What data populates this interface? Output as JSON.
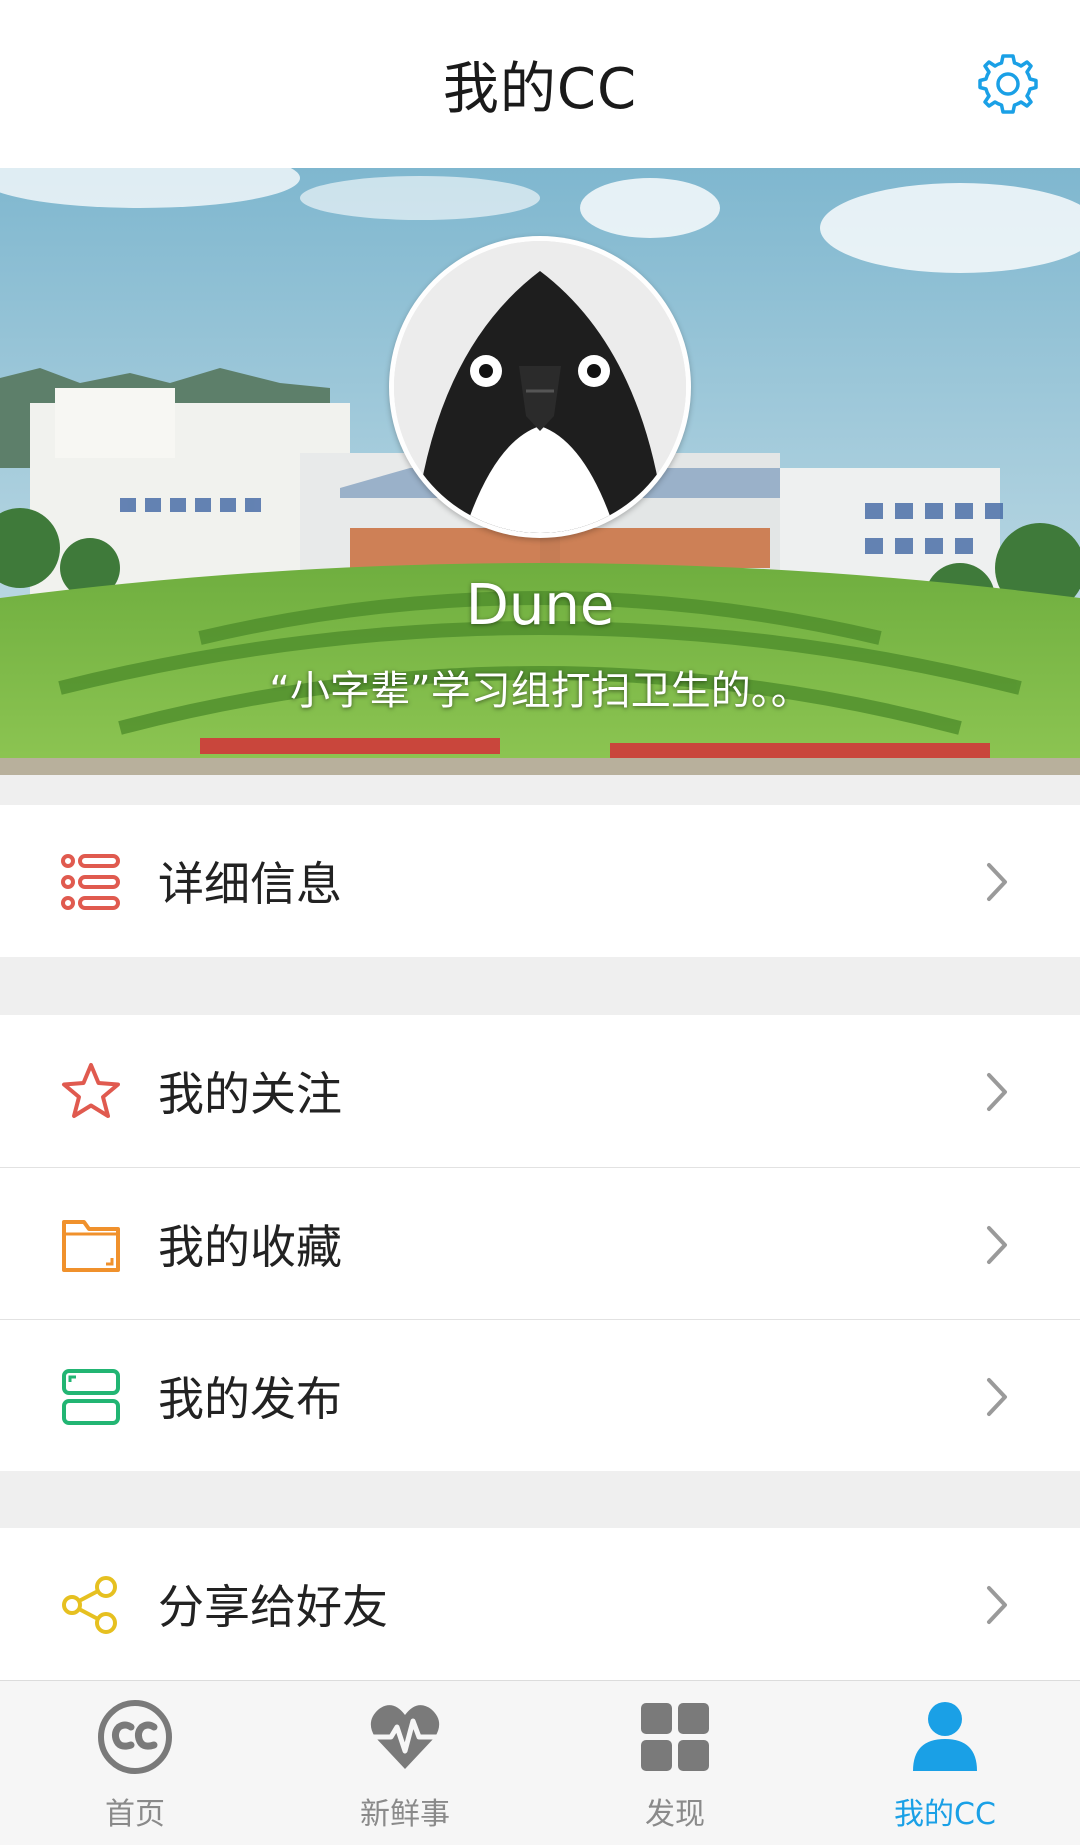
{
  "header": {
    "title": "我的CC",
    "settings_icon": "gear-icon"
  },
  "profile": {
    "name": "Dune",
    "bio": "“小字辈”学习组打扫卫生的。。",
    "avatar_icon": "penguin-avatar"
  },
  "menu_groups": [
    [
      {
        "label": "详细信息",
        "icon": "list-icon",
        "color": "#e05a4f"
      }
    ],
    [
      {
        "label": "我的关注",
        "icon": "star-icon",
        "color": "#e05a4f"
      },
      {
        "label": "我的收藏",
        "icon": "folder-icon",
        "color": "#f0912c"
      },
      {
        "label": "我的发布",
        "icon": "layers-icon",
        "color": "#22b573"
      }
    ],
    [
      {
        "label": "分享给好友",
        "icon": "share-icon",
        "color": "#e6c020"
      }
    ]
  ],
  "tabs": [
    {
      "label": "首页",
      "icon": "cc-icon",
      "active": false
    },
    {
      "label": "新鲜事",
      "icon": "heartbeat-icon",
      "active": false
    },
    {
      "label": "发现",
      "icon": "grid-icon",
      "active": false
    },
    {
      "label": "我的CC",
      "icon": "user-icon",
      "active": true
    }
  ],
  "colors": {
    "accent": "#1aa0e6",
    "inactive_tab": "#8a8a8a",
    "page_bg": "#efefef"
  }
}
